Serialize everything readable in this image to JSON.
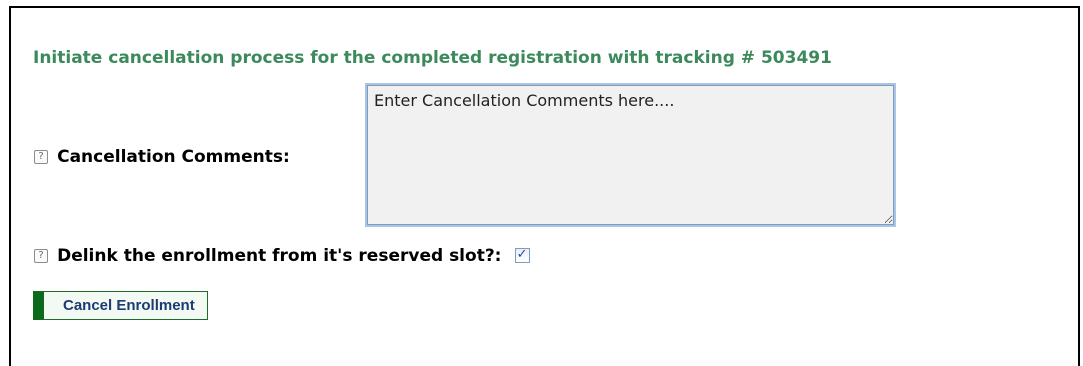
{
  "heading": "Initiate cancellation process for the completed registration with tracking # 503491",
  "comments": {
    "label": "Cancellation Comments:",
    "value": "Enter Cancellation Comments here....",
    "help_icon": "?"
  },
  "delink": {
    "label": "Delink the enrollment from it's reserved slot?:",
    "checked": true,
    "help_icon": "?"
  },
  "cancel_button": {
    "label": "Cancel Enrollment"
  },
  "colors": {
    "heading": "#3c8a5c",
    "button_accent": "#0d6a1c",
    "button_text": "#1d3b73"
  }
}
